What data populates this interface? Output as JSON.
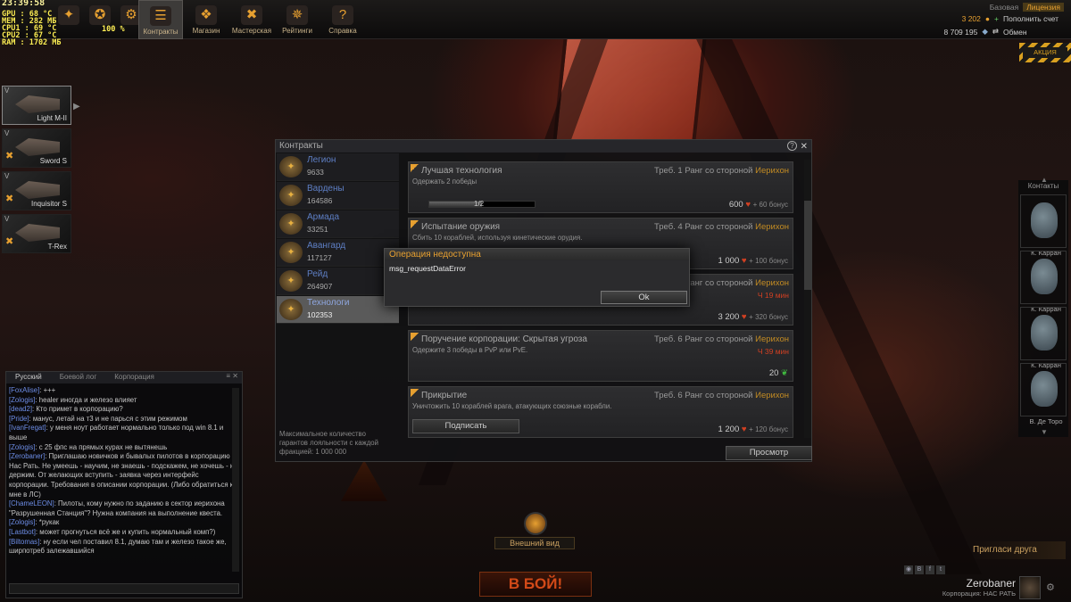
{
  "osd": {
    "clock": "23:39:58",
    "lines": [
      "GPU  :  68 °C",
      "MEM  :  282 МБ",
      "CPU1 :  69 °C",
      "CPU2 :  67 °C",
      "RAM  :  1702 МБ"
    ],
    "percent": "100 %"
  },
  "topnav": [
    {
      "label": "",
      "icon": "logo-icon",
      "glyph": "✦"
    },
    {
      "label": "",
      "icon": "medal-icon",
      "glyph": "✪"
    },
    {
      "label": "",
      "icon": "gear-icon",
      "glyph": "⚙"
    },
    {
      "label": "Контракты",
      "icon": "contracts-icon",
      "glyph": "☰",
      "active": true
    },
    {
      "label": "Магазин",
      "icon": "shop-icon",
      "glyph": "❖"
    },
    {
      "label": "Мастерская",
      "icon": "workshop-icon",
      "glyph": "✖"
    },
    {
      "label": "Рейтинги",
      "icon": "ratings-icon",
      "glyph": "✵"
    },
    {
      "label": "Справка",
      "icon": "help-icon",
      "glyph": "?"
    }
  ],
  "account": {
    "base_label": "Базовая",
    "license": "Лицензия",
    "credits": "3 202",
    "topup": "Пополнить счет",
    "silver": "8 709 195",
    "exchange": "Обмен"
  },
  "promo": "АКЦИЯ",
  "ships": [
    {
      "name": "Light M-II",
      "tag": "V",
      "icon": "ship-light-icon"
    },
    {
      "name": "Sword S",
      "tag": "V",
      "icon": "ship-sword-icon"
    },
    {
      "name": "Inquisitor S",
      "tag": "V",
      "icon": "ship-inquisitor-icon"
    },
    {
      "name": "T-Rex",
      "tag": "V",
      "icon": "ship-trex-icon"
    }
  ],
  "chat": {
    "tabs": [
      "Русский",
      "Боевой лог",
      "Корпорация"
    ],
    "messages": [
      {
        "user": "[FoxAlise]",
        "text": ": +++"
      },
      {
        "user": "[Zologis]",
        "text": ": healer  иногда и железо влияет"
      },
      {
        "user": "[dead2]",
        "text": ": Кто примет в корпорацию?"
      },
      {
        "user": "[Pride]",
        "text": ": манус, летай на т3 и не парься с этим режимом"
      },
      {
        "user": "[IvanFregat]",
        "text": ": у меня ноут работает нормально только под win 8.1 и выше"
      },
      {
        "user": "[Zologis]",
        "text": ": с 25 фпс на прямых курах не вытянешь"
      },
      {
        "user": "[Zerobaner]",
        "text": ": Приглашаю новичков и бывалых пилотов в корпорацию Нас Рать. Не умеешь - научим, не знаешь - подскажем, не хочешь - не держим. От желающих вступить - заявка через интерфейс корпорации. Требования в описании корпорации. (Либо обратиться ко мне в ЛС)"
      },
      {
        "user": "[ChameLEON]",
        "text": ": Пилоты, кому нужно по заданию в сектор иерихона \"Разрушенная Станция\"? Нужна компания на выполнение квеста."
      },
      {
        "user": "[Zologis]",
        "text": ": *рукак"
      },
      {
        "user": "[Lastbot]",
        "text": ": может прогнуться всё же и купить нормальный комп?)"
      },
      {
        "user": "[Biltomas]",
        "text": ": ну если чел поставил 8.1, думаю там и железо такое же, ширпотреб залежавшийся"
      }
    ]
  },
  "contracts": {
    "title": "Контракты",
    "factions": [
      {
        "name": "Легион",
        "value": "9633"
      },
      {
        "name": "Вардены",
        "value": "164586"
      },
      {
        "name": "Армада",
        "value": "33251"
      },
      {
        "name": "Авангард",
        "value": "117127"
      },
      {
        "name": "Рейд",
        "value": "264907"
      },
      {
        "name": "Технологи",
        "value": "102353",
        "active": true
      }
    ],
    "note": "Максимальное количество гарантов лояльности с каждой фракцией: 1 000 000",
    "cards": [
      {
        "title": "Лучшая технология",
        "desc": "Одержать 2 победы",
        "req": "Треб. 1 Ранг со стороной",
        "faction": "Иерихон",
        "red": "",
        "progress": "1/2",
        "reward": "600",
        "bonus": "+ 60 бонус",
        "cur": "heart"
      },
      {
        "title": "Испытание оружия",
        "desc": "Сбить 10 кораблей, используя кинетические орудия.",
        "req": "Треб. 4 Ранг со стороной",
        "faction": "Иерихон",
        "red": "",
        "reward": "1 000",
        "bonus": "+ 100 бонус",
        "cur": "heart"
      },
      {
        "title": "",
        "desc": "",
        "req": "Треб. 4 Ранг со стороной",
        "faction": "Иерихон",
        "red": "Ч   19 мин",
        "reward": "3 200",
        "bonus": "+ 320 бонус",
        "cur": "heart"
      },
      {
        "title": "Поручение корпорации: Скрытая угроза",
        "desc": "Одержите 3 победы в PvP или PvE.",
        "req": "Треб. 6 Ранг со стороной",
        "faction": "Иерихон",
        "red": "Ч   39 мин",
        "reward": "20",
        "bonus": "",
        "cur": "green"
      },
      {
        "title": "Прикрытие",
        "desc": "Уничтожить 10 кораблей врага, атакующих союзные корабли.",
        "req": "Треб. 6 Ранг со стороной",
        "faction": "Иерихон",
        "red": "",
        "reward": "1 200",
        "bonus": "+ 120 бонус",
        "cur": "heart",
        "sign": "Подписать"
      }
    ],
    "view_button": "Просмотр"
  },
  "error_dialog": {
    "title": "Операция недоступна",
    "message": "msg_requestDataError",
    "ok": "Ok"
  },
  "contacts": {
    "title": "Контакты",
    "list": [
      "К. Карран",
      "К. Карран",
      "К. Карран",
      "В. Де Торо"
    ]
  },
  "bottom": {
    "battle": "В БОЙ!",
    "external_view": "Внешний вид",
    "invite": "Пригласи друга",
    "username": "Zerobaner",
    "corp": "Корпорация: НАС РАТЬ"
  }
}
